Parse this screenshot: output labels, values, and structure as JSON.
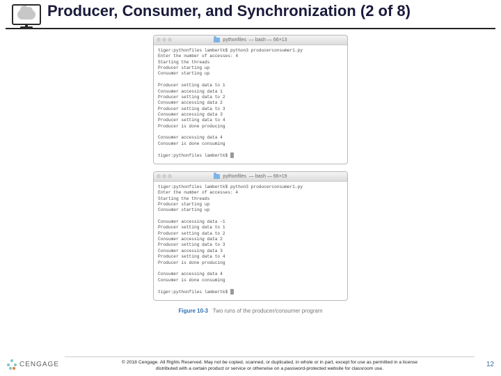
{
  "slide": {
    "title": "Producer, Consumer, and Synchronization (2 of 8)"
  },
  "terminal1": {
    "titlebar_path": "pythonfiles",
    "titlebar_meta": "— bash — 66×13",
    "lines": [
      "tiger:pythonfiles lambertk$ python3 producerconsumer1.py",
      "Enter the number of accesses: 4",
      "Starting the threads",
      "Producer starting up",
      "Consumer starting up",
      "",
      "Producer setting data to 1",
      "Consumer accessing data 1",
      "Producer setting data to 2",
      "Consumer accessing data 2",
      "Producer setting data to 3",
      "Consumer accessing data 3",
      "Producer setting data to 4",
      "Producer is done producing",
      "",
      "Consumer accessing data 4",
      "Consumer is done consuming",
      "",
      "tiger:pythonfiles lambertk$ "
    ]
  },
  "terminal2": {
    "titlebar_path": "pythonfiles",
    "titlebar_meta": "— bash — 66×19",
    "lines": [
      "tiger:pythonfiles lambertk$ python3 producerconsumer1.py",
      "Enter the number of accesses: 4",
      "Starting the threads",
      "Producer starting up",
      "Consumer starting up",
      "",
      "Consumer accessing data -1",
      "Producer setting data to 1",
      "Producer setting data to 2",
      "Consumer accessing data 2",
      "Producer setting data to 3",
      "Consumer accessing data 3",
      "Producer setting data to 4",
      "Producer is done producing",
      "",
      "Consumer accessing data 4",
      "Consumer is done consuming",
      "",
      "tiger:pythonfiles lambertk$ "
    ]
  },
  "figure": {
    "label": "Figure 10-3",
    "caption": "Two runs of the producer/consumer program"
  },
  "footer": {
    "brand": "CENGAGE",
    "copyright1": "© 2018 Cengage. All Rights Reserved. May not be copied, scanned, or duplicated, in whole or in part, except for use as permitted in a license",
    "copyright2": "distributed with a certain product or service or otherwise on a password-protected website for classroom use.",
    "page": "12"
  }
}
